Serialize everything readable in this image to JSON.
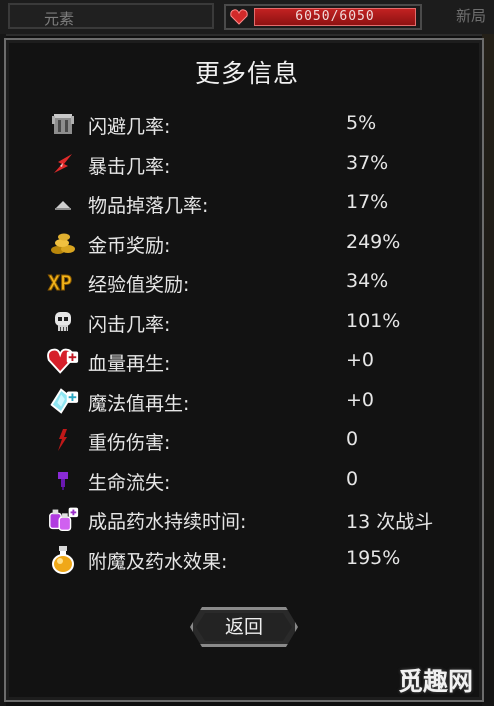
{
  "topbar": {
    "elements_tab": "元素",
    "hp_text": "6050/6050",
    "new_tab": "新局"
  },
  "dialog": {
    "title": "更多信息",
    "back_label": "返回"
  },
  "stats": [
    {
      "label": "闪避几率:",
      "value": "5%",
      "icon": "armor-icon"
    },
    {
      "label": "暴击几率:",
      "value": "37%",
      "icon": "crit-spark-icon"
    },
    {
      "label": "物品掉落几率:",
      "value": "17%",
      "icon": "drop-pile-icon"
    },
    {
      "label": "金币奖励:",
      "value": "249%",
      "icon": "gold-coins-icon"
    },
    {
      "label": "经验值奖励:",
      "value": "34%",
      "icon": "xp-icon"
    },
    {
      "label": "闪击几率:",
      "value": "101%",
      "icon": "skull-icon"
    },
    {
      "label": "血量再生:",
      "value": "+0",
      "icon": "heart-plus-icon"
    },
    {
      "label": "魔法值再生:",
      "value": "+0",
      "icon": "crystal-plus-icon"
    },
    {
      "label": "重伤伤害:",
      "value": "0",
      "icon": "blood-drop-icon"
    },
    {
      "label": "生命流失:",
      "value": "0",
      "icon": "purple-drip-icon"
    },
    {
      "label": "成品药水持续时间:",
      "value": "13 次战斗",
      "icon": "potions-icon"
    },
    {
      "label": "附魔及药水效果:",
      "value": "195%",
      "icon": "potion-bottle-icon"
    }
  ],
  "watermark": "觅趣网",
  "colors": {
    "background": "#121212",
    "border": "#6c6c6c",
    "hp_bar": "#c22222",
    "text": "#e6e6e6"
  }
}
